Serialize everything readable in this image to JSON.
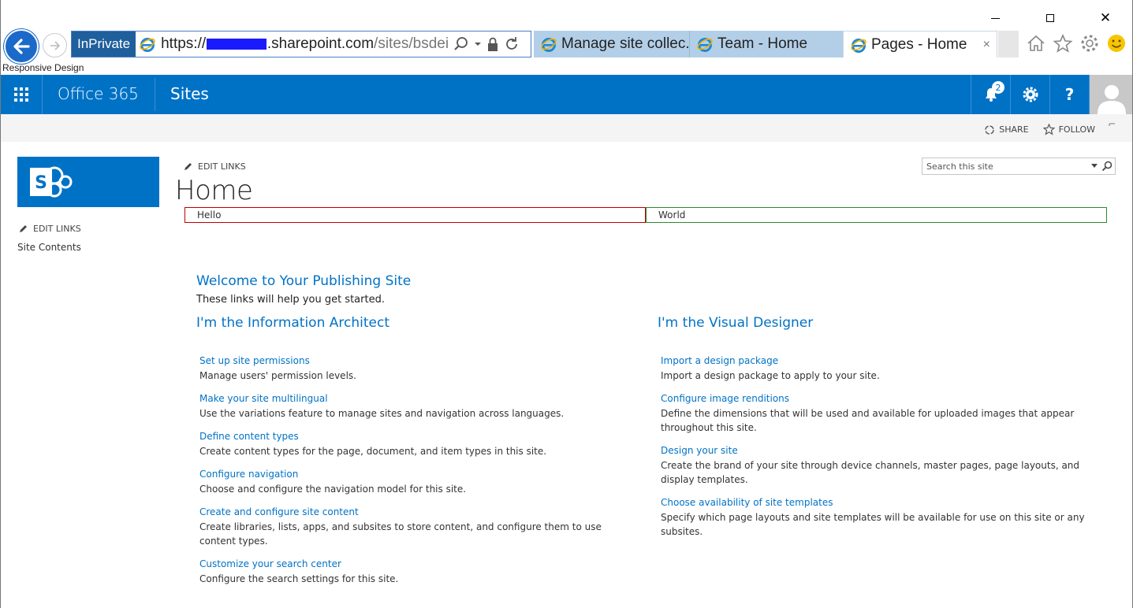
{
  "browser": {
    "inprivate_label": "InPrivate",
    "url_prefix": "https://",
    "url_domain": ".sharepoint.com",
    "url_path": "/sites/bsdei",
    "tabs": [
      {
        "label": "Manage site collec..."
      },
      {
        "label": "Team - Home"
      },
      {
        "label": "Pages - Home",
        "close": "×"
      }
    ],
    "page_title": "Responsive Design"
  },
  "suite_bar": {
    "brand": "Office 365",
    "app": "Sites",
    "notification_count": "2",
    "help_label": "?"
  },
  "ribbon": {
    "share_label": "SHARE",
    "follow_label": "FOLLOW"
  },
  "left_nav": {
    "edit_links": "EDIT LINKS",
    "items": [
      {
        "label": "Site Contents"
      }
    ]
  },
  "main": {
    "edit_links": "EDIT LINKS",
    "title": "Home",
    "search_placeholder": "Search this site",
    "cells": {
      "hello": "Hello",
      "world": "World"
    },
    "welcome": {
      "title": "Welcome to Your Publishing Site",
      "subtitle": "These links will help you get started."
    },
    "columns": [
      {
        "title": "I'm the Information Architect",
        "links": [
          {
            "title": "Set up site permissions",
            "desc": "Manage users' permission levels."
          },
          {
            "title": "Make your site multilingual",
            "desc": "Use the variations feature to manage sites and navigation across languages."
          },
          {
            "title": "Define content types",
            "desc": "Create content types for the page, document, and item types in this site."
          },
          {
            "title": "Configure navigation",
            "desc": "Choose and configure the navigation model for this site."
          },
          {
            "title": "Create and configure site content",
            "desc": "Create libraries, lists, apps, and subsites to store content, and configure them to use content types."
          },
          {
            "title": "Customize your search center",
            "desc": "Configure the search settings for this site."
          }
        ]
      },
      {
        "title": "I'm the Visual Designer",
        "links": [
          {
            "title": "Import a design package",
            "desc": "Import a design package to apply to your site."
          },
          {
            "title": "Configure image renditions",
            "desc": "Define the dimensions that will be used and available for uploaded images that appear throughout this site."
          },
          {
            "title": "Design your site",
            "desc": "Create the brand of your site through device channels, master pages, page layouts, and display templates."
          },
          {
            "title": "Choose availability of site templates",
            "desc": "Specify which page layouts and site templates will be available for use on this site or any subsites."
          }
        ]
      }
    ]
  },
  "colors": {
    "suite_bar": "#0072c6",
    "link": "#0072c6",
    "hello_border": "#c00000",
    "world_border": "#2e8b2e"
  },
  "icons": {
    "back": "back-arrow-icon",
    "forward": "forward-arrow-icon",
    "ie": "internet-explorer-icon",
    "search": "search-icon",
    "lock": "lock-icon",
    "refresh": "refresh-icon",
    "home": "home-icon",
    "favorites": "star-icon",
    "tools": "gear-icon",
    "feedback": "smiley-icon",
    "waffle": "app-launcher-icon",
    "bell": "bell-icon",
    "settings": "gear-icon",
    "pencil": "pencil-icon",
    "sharepoint": "sharepoint-logo"
  }
}
